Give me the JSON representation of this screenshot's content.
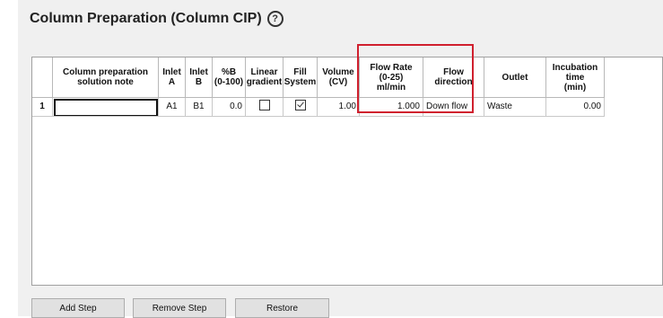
{
  "header": {
    "title": "Column Preparation (Column CIP)",
    "help_icon": "?"
  },
  "table": {
    "columns": [
      "",
      "Column preparation\nsolution note",
      "Inlet\nA",
      "Inlet\nB",
      "%B\n(0-100)",
      "Linear\ngradient",
      "Fill\nSystem",
      "Volume\n(CV)",
      "Flow Rate\n(0-25)\nml/min",
      "Flow\ndirection",
      "Outlet",
      "Incubation\ntime\n(min)"
    ],
    "rows": [
      {
        "number": "1",
        "note": "",
        "inlet_a": "A1",
        "inlet_b": "B1",
        "percent_b": "0.0",
        "linear_gradient": false,
        "fill_system": true,
        "volume": "1.00",
        "flow_rate": "1.000",
        "flow_direction": "Down flow",
        "outlet": "Waste",
        "incubation_time": "0.00"
      }
    ]
  },
  "buttons": {
    "add_step": "Add Step",
    "remove_step": "Remove Step",
    "restore": "Restore"
  },
  "colors": {
    "highlight": "#d0202e",
    "panel_bg": "#f0f0f0"
  }
}
